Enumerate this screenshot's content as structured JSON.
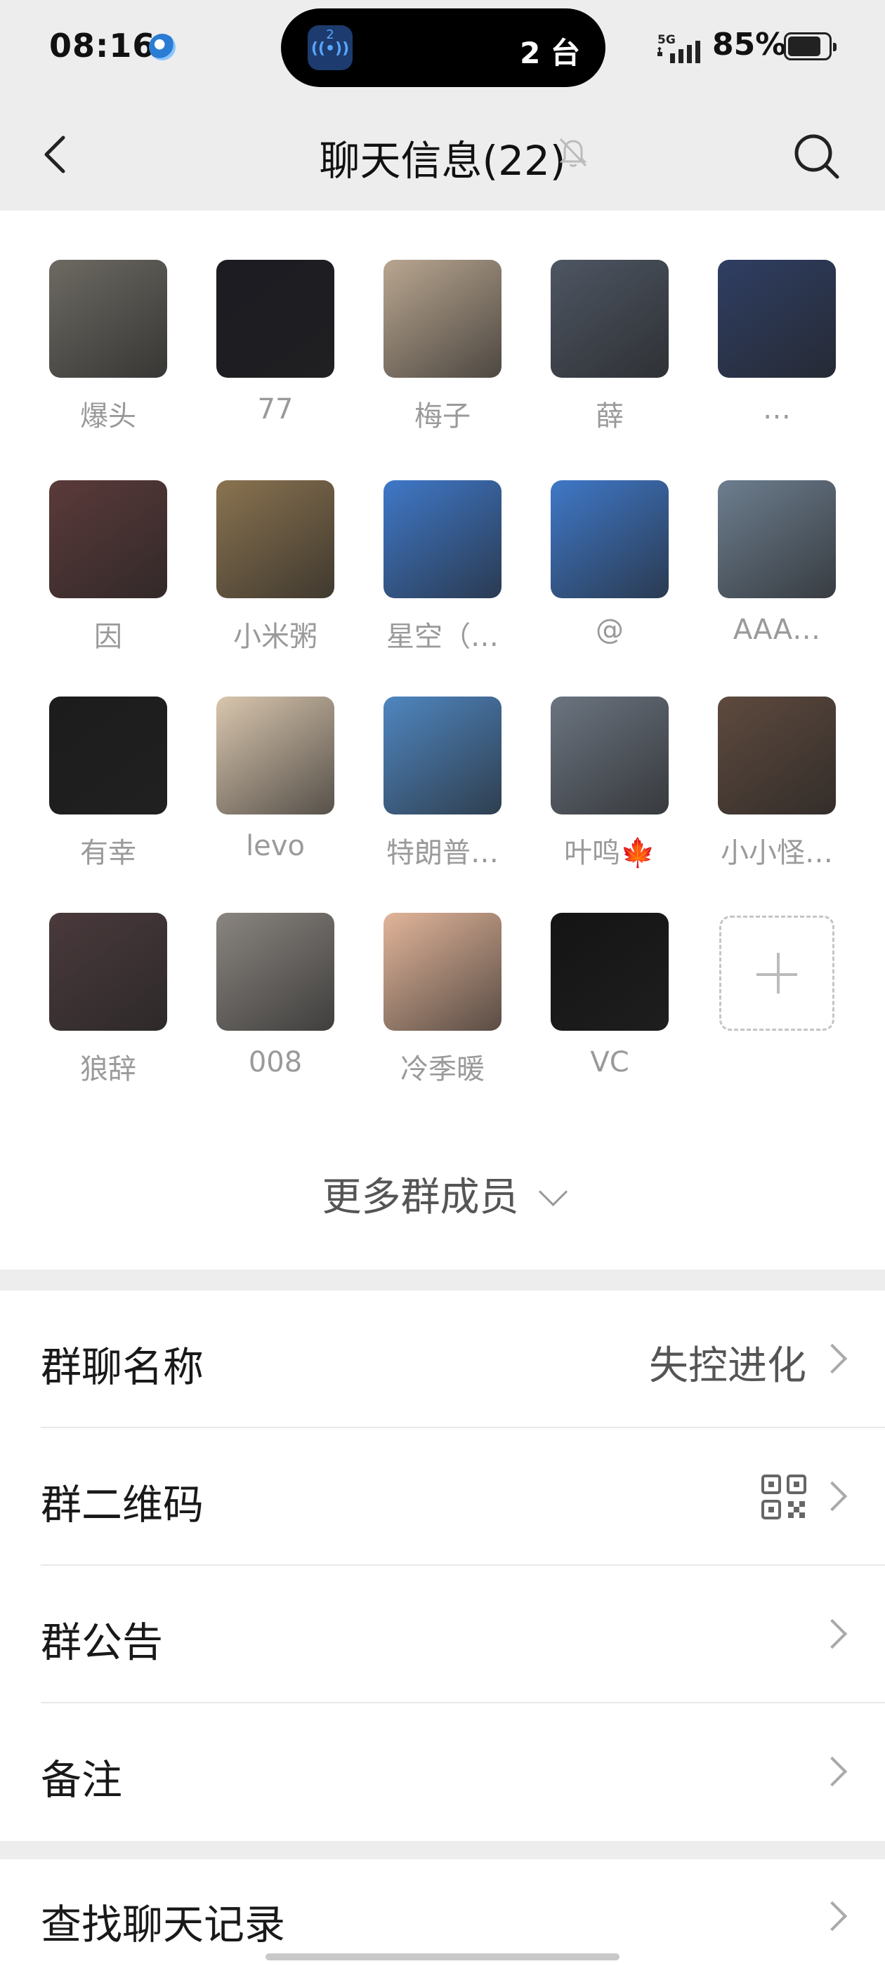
{
  "status_bar": {
    "time": "08:16",
    "island_badge": "2",
    "island_text": "2 台",
    "network": "5G",
    "battery": "85%"
  },
  "nav": {
    "title": "聊天信息(22)",
    "back_icon": "chevron-left-icon",
    "mute_icon": "bell-off-icon",
    "search_icon": "search-icon"
  },
  "members": [
    {
      "name": "爆头",
      "color": "#6d6a63"
    },
    {
      "name": "77",
      "color": "#1b1b22"
    },
    {
      "name": "梅子",
      "color": "#b9a690"
    },
    {
      "name": "薛",
      "color": "#4e5663"
    },
    {
      "name": "…",
      "color": "#2f3e63"
    },
    {
      "name": "因",
      "color": "#5b3a3a"
    },
    {
      "name": "小米粥",
      "color": "#8a7350"
    },
    {
      "name": "星空（…",
      "color": "#3f78c8"
    },
    {
      "name": "@",
      "color": "#3f78c8"
    },
    {
      "name": "AAA…",
      "color": "#6d7e8f"
    },
    {
      "name": "有幸",
      "color": "#1c1c1c"
    },
    {
      "name": "levo",
      "color": "#d9c6ae"
    },
    {
      "name": "特朗普…",
      "color": "#4f86c0"
    },
    {
      "name": "叶鸣🍁",
      "color": "#6b7480"
    },
    {
      "name": "小小怪…",
      "color": "#5e4a3e"
    },
    {
      "name": "狼辞",
      "color": "#4a3a3c"
    },
    {
      "name": "008",
      "color": "#8a8580"
    },
    {
      "name": "冷季暖",
      "color": "#e2b59a"
    },
    {
      "name": "VC",
      "color": "#141414"
    }
  ],
  "add_member_icon": "plus-icon",
  "more_members": "更多群成员",
  "settings": {
    "group_name_label": "群聊名称",
    "group_name_value": "失控进化",
    "qr_label": "群二维码",
    "notice_label": "群公告",
    "remark_label": "备注",
    "search_history_label": "查找聊天记录"
  }
}
